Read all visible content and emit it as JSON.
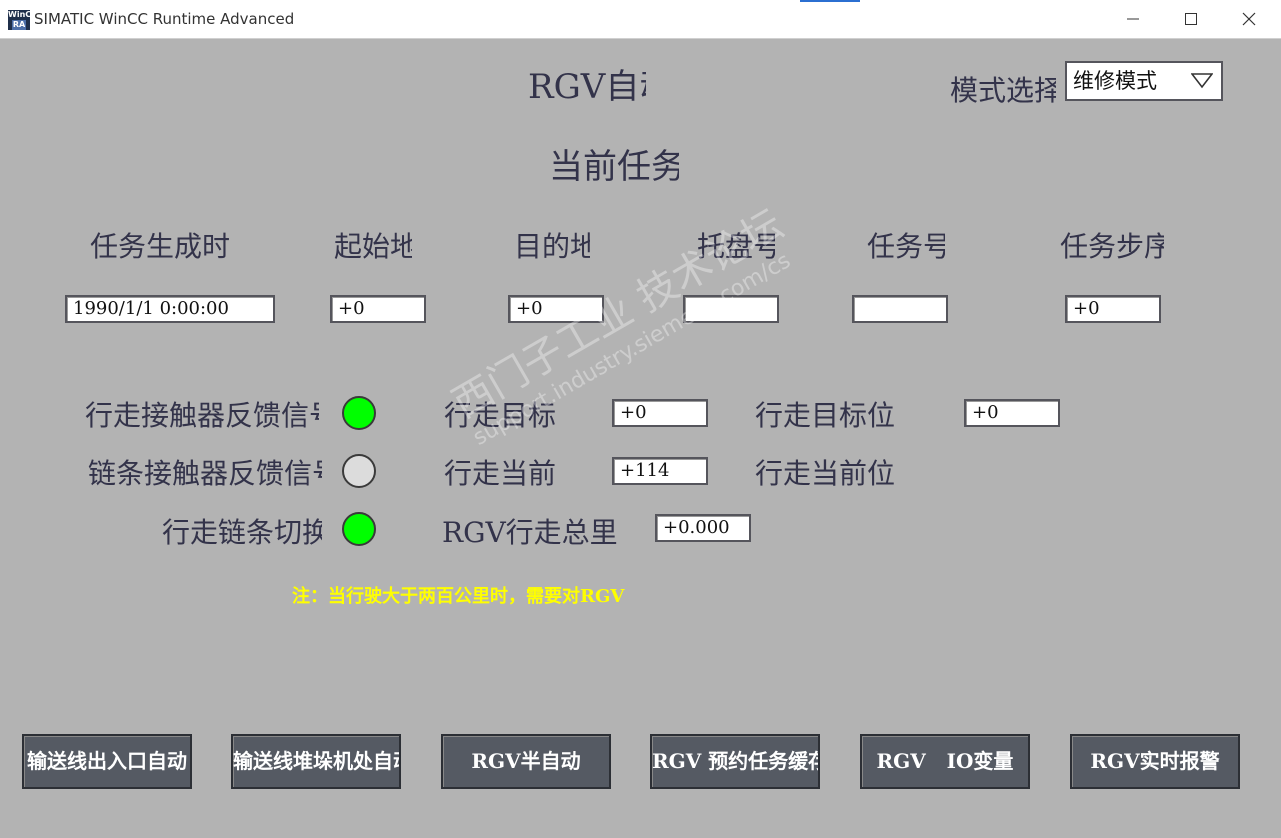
{
  "window": {
    "title": "SIMATIC WinCC Runtime Advanced",
    "icon_text_top": "WinC",
    "icon_text_bottom": "RA"
  },
  "header": {
    "title": "RGV自动",
    "mode_label": "模式选择",
    "mode_value": "维修模式",
    "current_task_label": "当前任务"
  },
  "task_table": {
    "columns": [
      "任务生成时",
      "起始地",
      "目的地",
      "托盘号",
      "任务号",
      "任务步序"
    ],
    "values": [
      "1990/1/1 0:00:00",
      "+0",
      "+0",
      "",
      "",
      "+0"
    ]
  },
  "status": {
    "walk_contactor_label": "行走接触器反馈信号",
    "chain_contactor_label": "链条接触器反馈信号",
    "walk_chain_switch_label": "行走链条切换",
    "lamp_colors": [
      "#00ff00",
      "#dcdcdc",
      "#00ff00"
    ],
    "walk_target_label": "行走目标",
    "walk_target_value": "+0",
    "walk_target_pos_label": "行走目标位",
    "walk_target_pos_value": "+0",
    "walk_current_label": "行走当前",
    "walk_current_value": "+114",
    "walk_current_pos_label": "行走当前位",
    "total_distance_label": "RGV行走总里程",
    "total_distance_value": "+0.000"
  },
  "note": "注：当行驶大于两百公里时，需要对RGV",
  "nav_buttons": [
    "输送线出入口自动",
    "输送线堆垛机处自动",
    "RGV半自动",
    "RGV 预约任务缓存",
    "RGV   IO变量",
    "RGV实时报警"
  ],
  "watermark": {
    "text": "西门子工业 技术论坛",
    "url": "support.industry.siemens.com/cs"
  }
}
